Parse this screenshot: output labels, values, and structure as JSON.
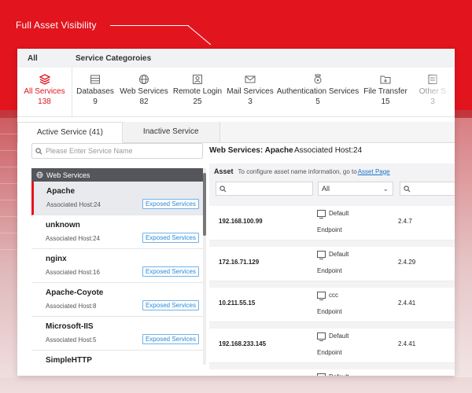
{
  "headline": "Full Asset Visibility",
  "header": {
    "all_label": "All",
    "categories_label": "Service Categoroies"
  },
  "categories": [
    {
      "label": "All Services",
      "count": "138",
      "icon": "layers-icon",
      "active": true
    },
    {
      "label": "Databases",
      "count": "9",
      "icon": "database-icon"
    },
    {
      "label": "Web Services",
      "count": "82",
      "icon": "globe-icon"
    },
    {
      "label": "Remote Login",
      "count": "25",
      "icon": "user-login-icon"
    },
    {
      "label": "Mail Services",
      "count": "3",
      "icon": "mail-icon"
    },
    {
      "label": "Authentication Services",
      "count": "5",
      "icon": "badge-icon"
    },
    {
      "label": "File Transfer",
      "count": "15",
      "icon": "folder-icon"
    },
    {
      "label": "Other S",
      "count": "3",
      "icon": "more-icon"
    }
  ],
  "tabs": {
    "active": "Active Service (41)",
    "inactive": "Inactive Service"
  },
  "service_search": {
    "placeholder": "Please Enter Service Name"
  },
  "detail": {
    "title": "Web Services: Apache",
    "associated": "Associated Host:24"
  },
  "service_group": "Web Services",
  "services": [
    {
      "name": "Apache",
      "host": "Associated Host:24",
      "badge": "Exposed Services"
    },
    {
      "name": "unknown",
      "host": "Associated Host:24",
      "badge": "Exposed Services"
    },
    {
      "name": "nginx",
      "host": "Associated Host:16",
      "badge": "Exposed Services"
    },
    {
      "name": "Apache-Coyote",
      "host": "Associated Host:8",
      "badge": "Exposed Services"
    },
    {
      "name": "Microsoft-IIS",
      "host": "Associated Host:5",
      "badge": "Exposed Services"
    },
    {
      "name": "SimpleHTTP",
      "host": "",
      "badge": ""
    }
  ],
  "asset": {
    "label": "Asset",
    "hint": "To configure asset name information, go to",
    "link": "Asset Page",
    "filter_select": "All",
    "rows": [
      {
        "ip": "192.168.100.99",
        "type": "Default",
        "role": "Endpoint",
        "version": "2.4.7"
      },
      {
        "ip": "172.16.71.129",
        "type": "Default",
        "role": "Endpoint",
        "version": "2.4.29"
      },
      {
        "ip": "10.211.55.15",
        "type": "ccc",
        "role": "Endpoint",
        "version": "2.4.41"
      },
      {
        "ip": "192.168.233.145",
        "type": "Default",
        "role": "Endpoint",
        "version": "2.4.41"
      },
      {
        "ip": "",
        "type": "Default",
        "role": "",
        "version": ""
      }
    ]
  },
  "colors": {
    "accent": "#e2141e",
    "link": "#1a73c8",
    "badge": "#2a8ad9"
  }
}
